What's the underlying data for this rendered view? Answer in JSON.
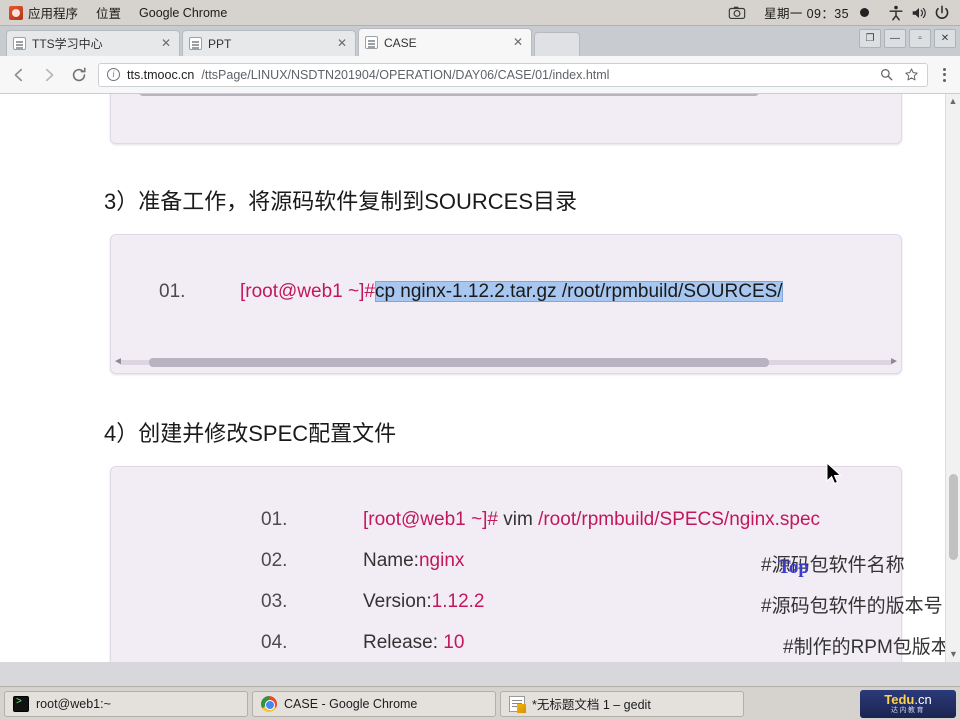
{
  "system_panel": {
    "applications_label": "应用程序",
    "places_label": "位置",
    "active_app_label": "Google Chrome",
    "clock": "星期一  09：35",
    "icons": {
      "apps": "app-grid-icon",
      "screenshot": "camera-icon",
      "accessibility": "accessibility-icon",
      "volume": "volume-icon",
      "power": "power-icon"
    }
  },
  "browser": {
    "tabs": [
      {
        "title": "TTS学习中心",
        "active": false,
        "close": "✕"
      },
      {
        "title": "PPT",
        "active": false,
        "close": "✕"
      },
      {
        "title": "CASE",
        "active": true,
        "close": "✕"
      }
    ],
    "window_controls": {
      "minimize": "—",
      "maximize": "▫",
      "close": "✕",
      "restore": "❐"
    },
    "toolbar": {
      "back": "←",
      "forward": "→",
      "reload": "⟳",
      "zoom_icon": "magnifier-icon",
      "bookmark_icon": "star-icon",
      "menu_icon": "three-dots-icon"
    },
    "omnibox": {
      "info_icon": "info-circle-icon",
      "host": "tts.tmooc.cn",
      "path": "/ttsPage/LINUX/NSDTN201904/OPERATION/DAY06/CASE/01/index.html"
    }
  },
  "page": {
    "headings": [
      {
        "text": "3）准备工作，将源码软件复制到SOURCES目录"
      },
      {
        "text": "4）创建并修改SPEC配置文件"
      }
    ],
    "top_link": "Top",
    "code_block_1": {
      "lines": [
        {
          "no": "01.",
          "prompt": "[root@web1 ~]#",
          "selected_text": "cp nginx-1.12.2.tar.gz /root/rpmbuild/SOURCES/"
        }
      ]
    },
    "code_block_2": {
      "lines": [
        {
          "no": "01.",
          "prompt": "[root@web1 ~]#",
          "cmd": "vim",
          "arg": "/root/rpmbuild/SPECS/nginx.spec",
          "comment": ""
        },
        {
          "no": "02.",
          "prompt": "",
          "cmd": "Name:",
          "arg": "nginx",
          "comment": "#源码包软件名称"
        },
        {
          "no": "03.",
          "prompt": "",
          "cmd": "Version:",
          "arg": "1.12.2",
          "comment": "#源码包软件的版本号"
        },
        {
          "no": "04.",
          "prompt": "",
          "cmd": "Release:",
          "arg": "10",
          "comment": "#制作的RPM包版本号"
        }
      ]
    },
    "watermark": {
      "main": "Tedu",
      "tld": ".cn",
      "sub": "达内教育"
    }
  },
  "taskbar": {
    "items": [
      {
        "label": "root@web1:~",
        "icon": "terminal-icon"
      },
      {
        "label": "CASE - Google Chrome",
        "icon": "chrome-icon"
      },
      {
        "label": "*无标题文档 1 – gedit",
        "icon": "gedit-icon"
      }
    ],
    "brand": {
      "main": "Tedu",
      "tld": ".cn",
      "sub": "达内教育"
    }
  },
  "colors": {
    "selection": "#a8c7f0",
    "code_bg": "#f2edf5",
    "accent_pink": "#c2185b",
    "panel_bg": "#d6d2cd"
  }
}
